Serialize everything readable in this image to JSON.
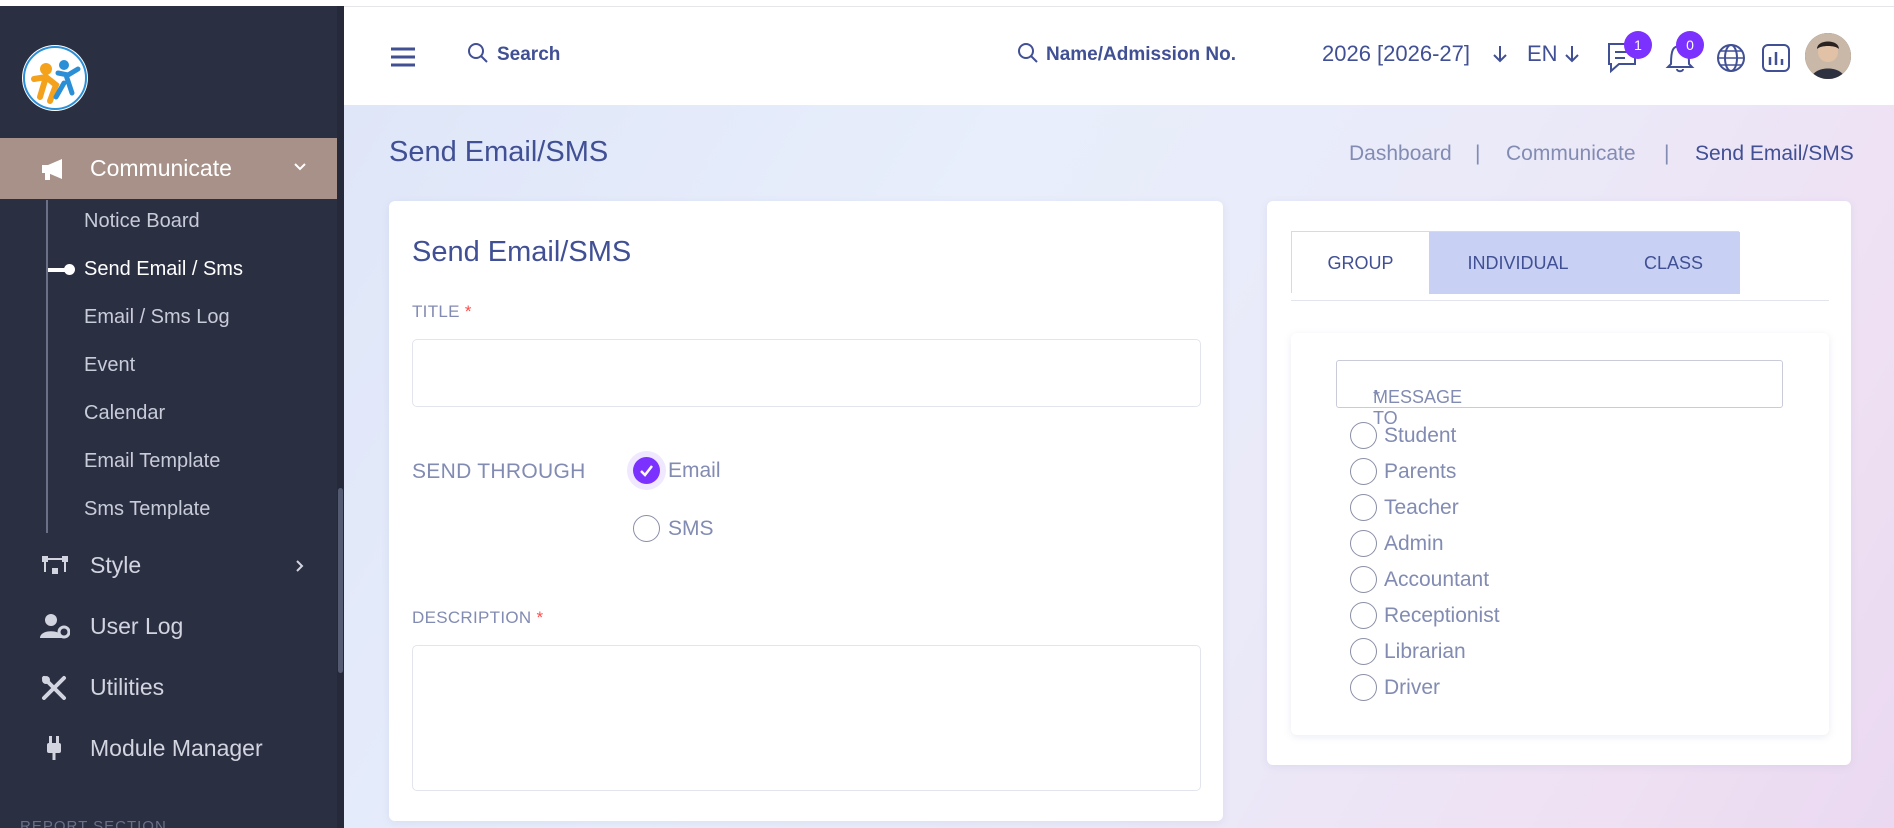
{
  "sidebar": {
    "communicate": {
      "label": "Communicate"
    },
    "sub_items": [
      {
        "label": "Notice Board"
      },
      {
        "label": "Send Email / Sms"
      },
      {
        "label": "Email / Sms Log"
      },
      {
        "label": "Event"
      },
      {
        "label": "Calendar"
      },
      {
        "label": "Email Template"
      },
      {
        "label": "Sms Template"
      }
    ],
    "items": [
      {
        "label": "Style",
        "icon": "style-icon"
      },
      {
        "label": "User Log",
        "icon": "user-gear-icon"
      },
      {
        "label": "Utilities",
        "icon": "tools-icon"
      },
      {
        "label": "Module Manager",
        "icon": "plug-icon"
      }
    ],
    "section": "REPORT SECTION"
  },
  "topbar": {
    "search_placeholder": "Search",
    "student_search": "Name/Admission No.",
    "session": "2026 [2026-27]",
    "language": "EN",
    "messages_count": "1",
    "notifications_count": "0"
  },
  "page": {
    "title": "Send Email/SMS",
    "breadcrumb": [
      "Dashboard",
      "|",
      "Communicate",
      "|",
      "Send Email/SMS"
    ]
  },
  "form": {
    "card_title": "Send Email/SMS",
    "title_label": "TITLE",
    "title_value": "",
    "send_through_label": "SEND THROUGH",
    "options": [
      {
        "label": "Email",
        "checked": true
      },
      {
        "label": "SMS",
        "checked": false
      }
    ],
    "description_label": "DESCRIPTION",
    "description_value": "",
    "required_mark": "*"
  },
  "recipients": {
    "tabs": [
      {
        "label": "GROUP",
        "active": true
      },
      {
        "label": "INDIVIDUAL",
        "active": false
      },
      {
        "label": "CLASS",
        "active": false
      }
    ],
    "message_to_label": "MESSAGE TO",
    "roles": [
      "Student",
      "Parents",
      "Teacher",
      "Admin",
      "Accountant",
      "Receptionist",
      "Librarian",
      "Driver"
    ]
  },
  "colors": {
    "accent": "#7c32ff",
    "sidebar": "#2b2f42",
    "active_menu": "#a79189",
    "text": "#415094",
    "muted": "#828bb2"
  }
}
